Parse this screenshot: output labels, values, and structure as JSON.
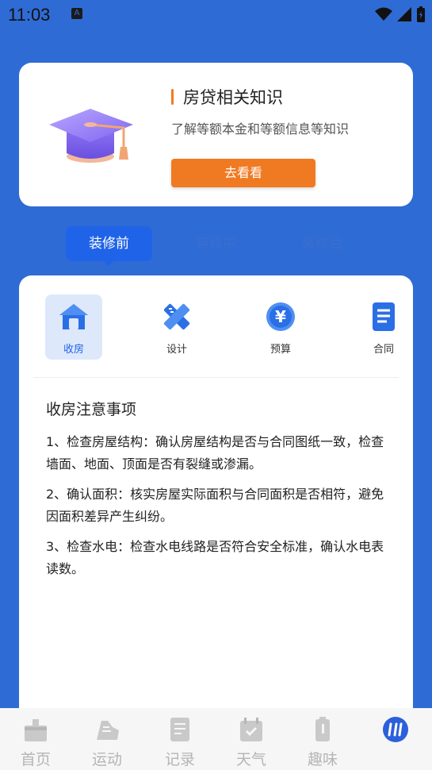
{
  "status": {
    "time": "11:03",
    "indicator": "A"
  },
  "promo": {
    "title": "房贷相关知识",
    "description": "了解等额本金和等额信息等知识",
    "button": "去看看",
    "icon": "graduation-cap-icon",
    "accent": "#f07a22"
  },
  "tabs": [
    {
      "label": "装修前",
      "active": true
    },
    {
      "label": "装修中",
      "active": false
    },
    {
      "label": "装修后",
      "active": false
    }
  ],
  "categories": [
    {
      "label": "收房",
      "icon": "house-icon",
      "active": true
    },
    {
      "label": "设计",
      "icon": "ruler-pencil-icon",
      "active": false
    },
    {
      "label": "预算",
      "icon": "yuan-coin-icon",
      "active": false
    },
    {
      "label": "合同",
      "icon": "document-icon",
      "active": false
    }
  ],
  "notes": {
    "title": "收房注意事项",
    "items": [
      "1、检查房屋结构：确认房屋结构是否与合同图纸一致，检查墙面、地面、顶面是否有裂缝或渗漏。",
      "2、确认面积：核实房屋实际面积与合同面积是否相符，避免因面积差异产生纠纷。",
      "3、检查水电：检查水电线路是否符合安全标准，确认水电表读数。"
    ]
  },
  "bottom_nav": [
    {
      "label": "首页",
      "icon": "home-icon"
    },
    {
      "label": "运动",
      "icon": "shoe-icon"
    },
    {
      "label": "记录",
      "icon": "notes-icon"
    },
    {
      "label": "天气",
      "icon": "calendar-icon"
    },
    {
      "label": "趣味",
      "icon": "battery-icon"
    },
    {
      "label": "",
      "icon": "app-logo-icon"
    }
  ],
  "colors": {
    "background": "#2f6bd4",
    "primary": "#1f63e8",
    "accent": "#f07a22"
  }
}
